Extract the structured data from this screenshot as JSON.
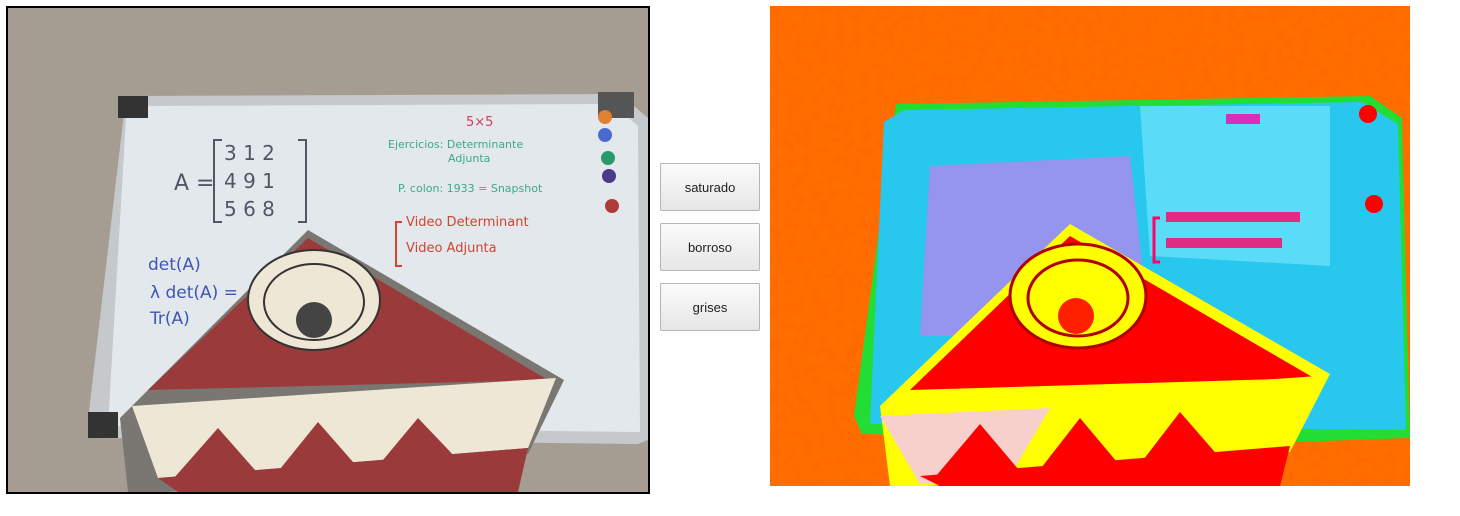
{
  "controls": {
    "filters": [
      {
        "label": "saturado"
      },
      {
        "label": "borroso"
      },
      {
        "label": "grises"
      }
    ]
  },
  "whiteboard": {
    "matrix_label": "A =",
    "matrix_rows": [
      "3   1   2",
      "4   9   1",
      "5   6   8"
    ],
    "size_note": "5×5",
    "note_lines": [
      "Ejercicios: Determinante",
      "Adjunta",
      "P. colon: 1933 = Snapshot"
    ],
    "bracket_lines": [
      "Video Determinant",
      "Video Adjunta"
    ],
    "formula_lines": [
      "det(A)",
      "λ det(A) =",
      "Tr(A)"
    ]
  },
  "colors": {
    "wall": "#a49c90",
    "board": "#e6ebef",
    "frame": "#c9ccd0",
    "puppet_red": "#9b3a3a",
    "puppet_cream": "#efe7d6",
    "marker_blue": "#3f55b5",
    "marker_green": "#3aa98e",
    "marker_red": "#d0452e",
    "filtered_orange": "#ff6a00",
    "filtered_cyan": "#27c7ee",
    "filtered_red": "#ff0000",
    "filtered_yellow": "#ffff00",
    "filtered_green": "#22dd33",
    "filtered_magenta": "#f06aee"
  },
  "icons": {
    "magnet_icons": [
      "orange-magnet-icon",
      "blue-magnet-icon",
      "green-magnet-icon",
      "purple-magnet-icon",
      "red-magnet-icon"
    ]
  }
}
